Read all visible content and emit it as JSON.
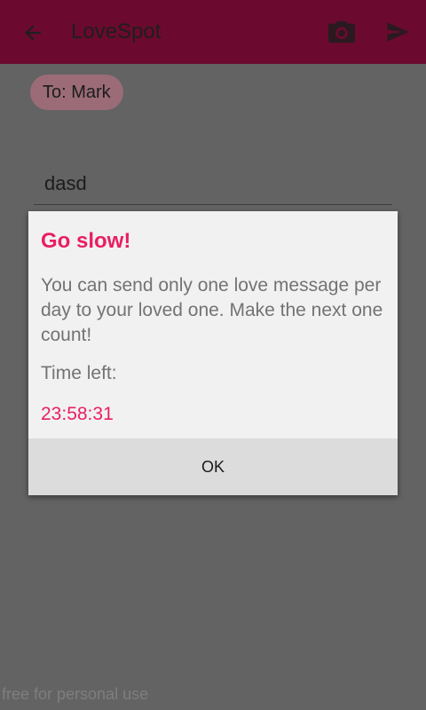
{
  "toolbar": {
    "title": "LoveSpot",
    "back_icon": "arrow-left-icon",
    "camera_icon": "camera-icon",
    "send_icon": "send-icon",
    "color": "#6b0a2e"
  },
  "compose": {
    "recipient": "To: Mark",
    "message_value": "dasd"
  },
  "dialog": {
    "title": "Go slow!",
    "message": "You can send only one love message per day to your loved one. Make the next one count!",
    "timer_label": "Time left:",
    "timer_value": "23:58:31",
    "ok_label": "OK",
    "accent_color": "#e91e63"
  },
  "watermark": "free for personal use"
}
